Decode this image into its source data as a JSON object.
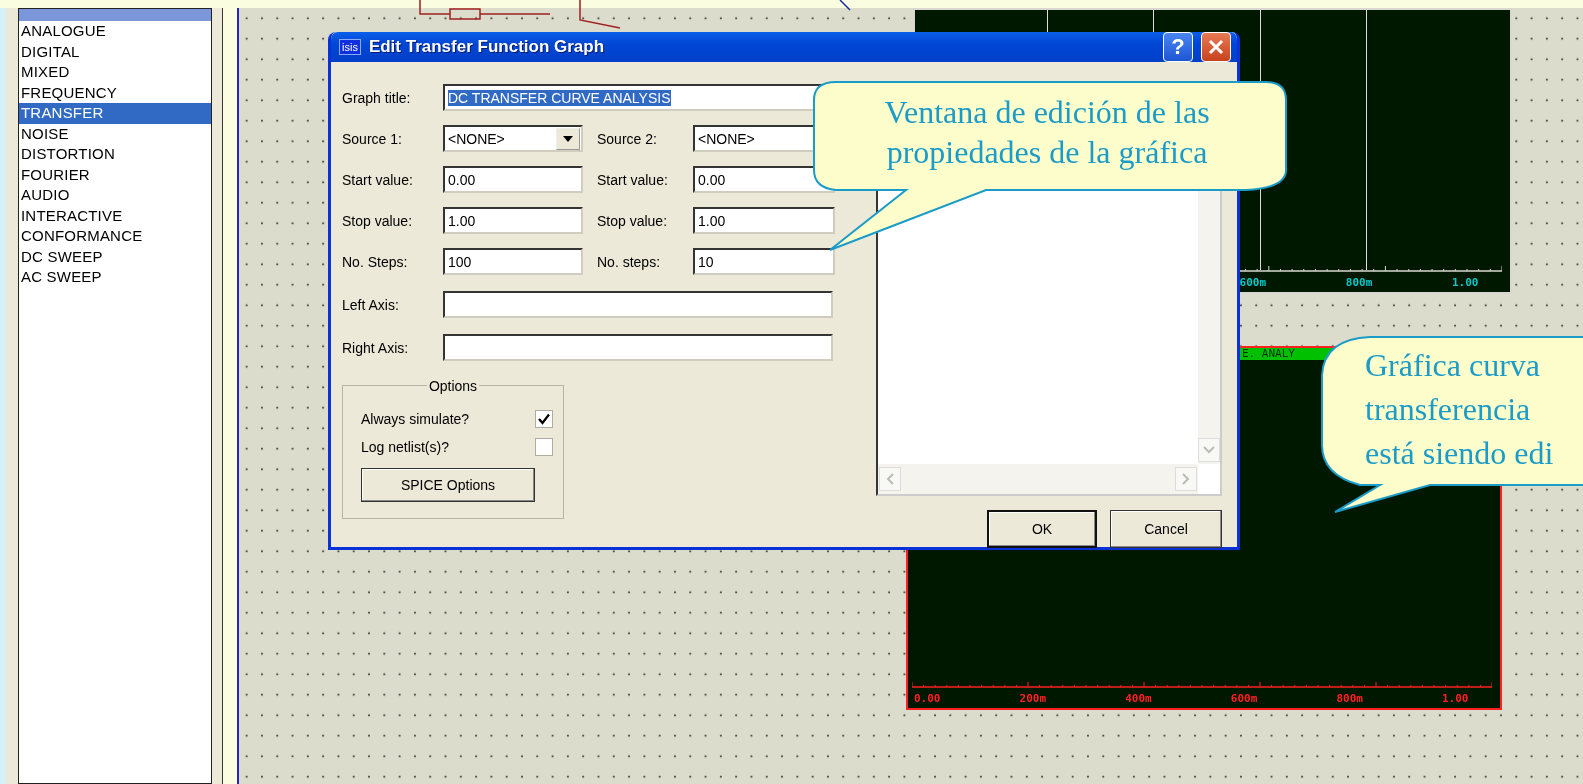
{
  "sidebar": {
    "items": [
      {
        "label": "ANALOGUE",
        "selected": false
      },
      {
        "label": "DIGITAL",
        "selected": false
      },
      {
        "label": "MIXED",
        "selected": false
      },
      {
        "label": "FREQUENCY",
        "selected": false
      },
      {
        "label": "TRANSFER",
        "selected": true
      },
      {
        "label": "NOISE",
        "selected": false
      },
      {
        "label": "DISTORTION",
        "selected": false
      },
      {
        "label": "FOURIER",
        "selected": false
      },
      {
        "label": "AUDIO",
        "selected": false
      },
      {
        "label": "INTERACTIVE",
        "selected": false
      },
      {
        "label": "CONFORMANCE",
        "selected": false
      },
      {
        "label": "DC SWEEP",
        "selected": false
      },
      {
        "label": "AC SWEEP",
        "selected": false
      }
    ]
  },
  "graphs": [
    {
      "kind": "plain",
      "x_labels": [
        "600m",
        "800m",
        "1.00"
      ]
    },
    {
      "kind": "edited",
      "title": "E. ANALY",
      "x_labels": [
        "0.00",
        "200m",
        "400m",
        "600m",
        "800m",
        "1.00"
      ]
    }
  ],
  "dialog": {
    "icon_text": "isis",
    "title": "Edit Transfer Function Graph",
    "help_glyph": "?",
    "graph_title": {
      "label": "Graph title:",
      "value": "DC TRANSFER CURVE ANALYSIS",
      "text_selected": true
    },
    "pairs": [
      {
        "label_1": "Source 1:",
        "value_1": "<NONE>",
        "label_2": "Source 2:",
        "value_2": "<NONE>",
        "kind": "combo"
      },
      {
        "label_1": "Start value:",
        "value_1": "0.00",
        "label_2": "Start value:",
        "value_2": "0.00",
        "kind": "text"
      },
      {
        "label_1": "Stop value:",
        "value_1": "1.00",
        "label_2": "Stop value:",
        "value_2": "1.00",
        "kind": "text"
      },
      {
        "label_1": "No. Steps:",
        "value_1": "100",
        "label_2": "No. steps:",
        "value_2": "10",
        "kind": "text"
      }
    ],
    "axes": [
      {
        "label": "Left Axis:"
      },
      {
        "label": "Right Axis:"
      }
    ],
    "options": {
      "title": "Options",
      "items": [
        {
          "label": "Always simulate?",
          "checked": true
        },
        {
          "label": "Log netlist(s)?",
          "checked": false
        }
      ],
      "button": "SPICE Options"
    },
    "ok": "OK",
    "cancel": "Cancel"
  },
  "callouts": [
    {
      "lines": [
        "Ventana de edición de las",
        "propiedades de la gráfica"
      ]
    },
    {
      "lines": [
        "Gráfica curva",
        "transferencia",
        "está siendo edi"
      ]
    }
  ]
}
